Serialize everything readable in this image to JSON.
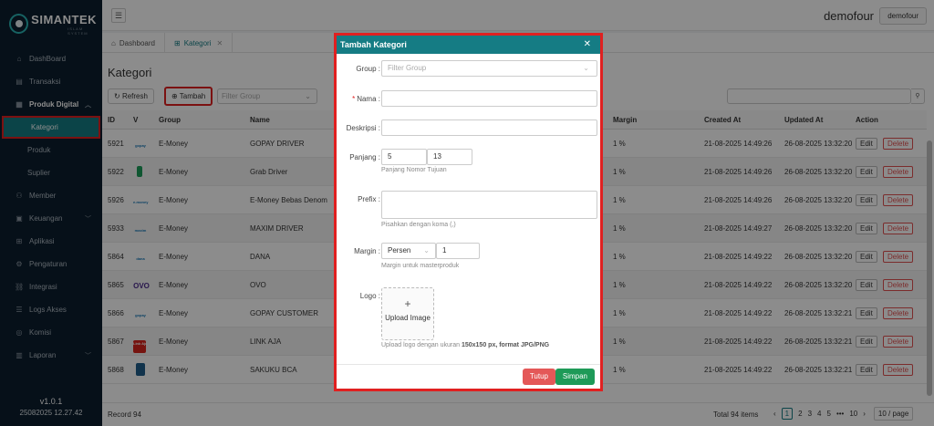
{
  "brand": {
    "title": "SIMANTEK",
    "subtitle": "ISLAM SYSTEM"
  },
  "sidebar": {
    "items": [
      {
        "label": "DashBoard",
        "icon": "home-icon"
      },
      {
        "label": "Transaksi",
        "icon": "receipt-icon"
      },
      {
        "label": "Produk Digital",
        "icon": "box-icon"
      },
      {
        "label": "Kategori"
      },
      {
        "label": "Produk"
      },
      {
        "label": "Suplier"
      },
      {
        "label": "Member",
        "icon": "users-icon"
      },
      {
        "label": "Keuangan",
        "icon": "wallet-icon"
      },
      {
        "label": "Aplikasi",
        "icon": "apps-icon"
      },
      {
        "label": "Pengaturan",
        "icon": "gear-icon"
      },
      {
        "label": "Integrasi",
        "icon": "link-icon"
      },
      {
        "label": "Logs Akses",
        "icon": "log-icon"
      },
      {
        "label": "Komisi",
        "icon": "coin-icon"
      },
      {
        "label": "Laporan",
        "icon": "report-icon"
      }
    ],
    "version": "v1.0.1",
    "build": "25082025 12.27.42"
  },
  "header": {
    "user_name": "demofour",
    "user_button": "demofour"
  },
  "tabs": [
    {
      "label": "Dashboard"
    },
    {
      "label": "Kategori"
    }
  ],
  "page": {
    "title": "Kategori"
  },
  "toolbar": {
    "refresh": "Refresh",
    "add": "Tambah",
    "filter_placeholder": "Filter Group"
  },
  "table": {
    "headers": {
      "id": "ID",
      "v": "V",
      "group": "Group",
      "name": "Name",
      "margin": "Margin",
      "created": "Created At",
      "updated": "Updated At",
      "action": "Action"
    },
    "rows": [
      {
        "id": "5921",
        "logo": "gopay",
        "group": "E-Money",
        "name": "GOPAY DRIVER",
        "margin": "1 %",
        "created": "21-08-2025 14:49:26",
        "updated": "26-08-2025 13:32:20"
      },
      {
        "id": "5922",
        "logo": "grab",
        "group": "E-Money",
        "name": "Grab Driver",
        "margin": "1 %",
        "created": "21-08-2025 14:49:26",
        "updated": "26-08-2025 13:32:20"
      },
      {
        "id": "5926",
        "logo": "emoney",
        "group": "E-Money",
        "name": "E-Money Bebas Denom",
        "margin": "1 %",
        "created": "21-08-2025 14:49:26",
        "updated": "26-08-2025 13:32:20"
      },
      {
        "id": "5933",
        "logo": "maxim",
        "group": "E-Money",
        "name": "MAXIM DRIVER",
        "margin": "1 %",
        "created": "21-08-2025 14:49:27",
        "updated": "26-08-2025 13:32:20"
      },
      {
        "id": "5864",
        "logo": "dana",
        "group": "E-Money",
        "name": "DANA",
        "margin": "1 %",
        "created": "21-08-2025 14:49:22",
        "updated": "26-08-2025 13:32:20"
      },
      {
        "id": "5865",
        "logo": "ovo",
        "group": "E-Money",
        "name": "OVO",
        "margin": "1 %",
        "created": "21-08-2025 14:49:22",
        "updated": "26-08-2025 13:32:20"
      },
      {
        "id": "5866",
        "logo": "gopay",
        "group": "E-Money",
        "name": "GOPAY CUSTOMER",
        "margin": "1 %",
        "created": "21-08-2025 14:49:22",
        "updated": "26-08-2025 13:32:21"
      },
      {
        "id": "5867",
        "logo": "linkaja",
        "group": "E-Money",
        "name": "LINK AJA",
        "margin": "1 %",
        "created": "21-08-2025 14:49:22",
        "updated": "26-08-2025 13:32:21"
      },
      {
        "id": "5868",
        "logo": "sakuku",
        "group": "E-Money",
        "name": "SAKUKU BCA",
        "margin": "1 %",
        "created": "21-08-2025 14:49:22",
        "updated": "26-08-2025 13:32:21"
      }
    ],
    "edit": "Edit",
    "delete": "Delete"
  },
  "footer": {
    "record": "Record 94",
    "total": "Total 94 items",
    "pages": [
      "1",
      "2",
      "3",
      "4",
      "5",
      "•••",
      "10"
    ],
    "page_size": "10 / page"
  },
  "modal": {
    "title": "Tambah Kategori",
    "group_label": "Group",
    "group_placeholder": "Filter Group",
    "nama_label": "Nama",
    "deskripsi_label": "Deskripsi",
    "panjang_label": "Panjang",
    "panjang_min": "5",
    "panjang_max": "13",
    "panjang_hint": "Panjang Nomor Tujuan",
    "prefix_label": "Prefix",
    "prefix_hint": "Pisahkan dengan koma (,)",
    "margin_label": "Margin",
    "margin_type": "Persen",
    "margin_value": "1",
    "margin_hint": "Margin untuk masterproduk",
    "logo_label": "Logo",
    "upload_text": "Upload Image",
    "logo_hint_prefix": "Upload logo dengan ukuran ",
    "logo_hint_bold": "150x150 px, format JPG/PNG",
    "tutup": "Tutup",
    "simpan": "Simpan"
  },
  "colors": {
    "accent": "#157c84",
    "sidebar": "#0c1e2e",
    "highlight": "#e02020",
    "save": "#1e9a58",
    "close": "#e45858"
  }
}
